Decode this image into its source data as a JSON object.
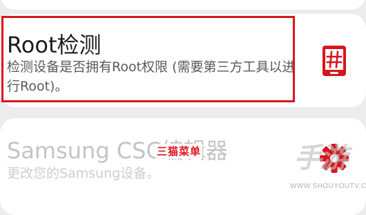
{
  "root_check": {
    "title": "Root检测",
    "description": "检测设备是否拥有Root权限 (需要第三方工具以进行Root)。",
    "icon": "hash-phone-icon"
  },
  "samsung_csc": {
    "title": "Samsung CSC编辑器",
    "description": "更改您的Samsung设备。",
    "icon": "gear-icon"
  },
  "overlay": {
    "label": "三猫菜单"
  },
  "watermark": {
    "brand": "手游",
    "url": "WWW.SHOUYOUTV.COM"
  },
  "colors": {
    "accent_red": "#d8151b",
    "card_bg": "#ffffff",
    "page_bg": "#ececec"
  }
}
